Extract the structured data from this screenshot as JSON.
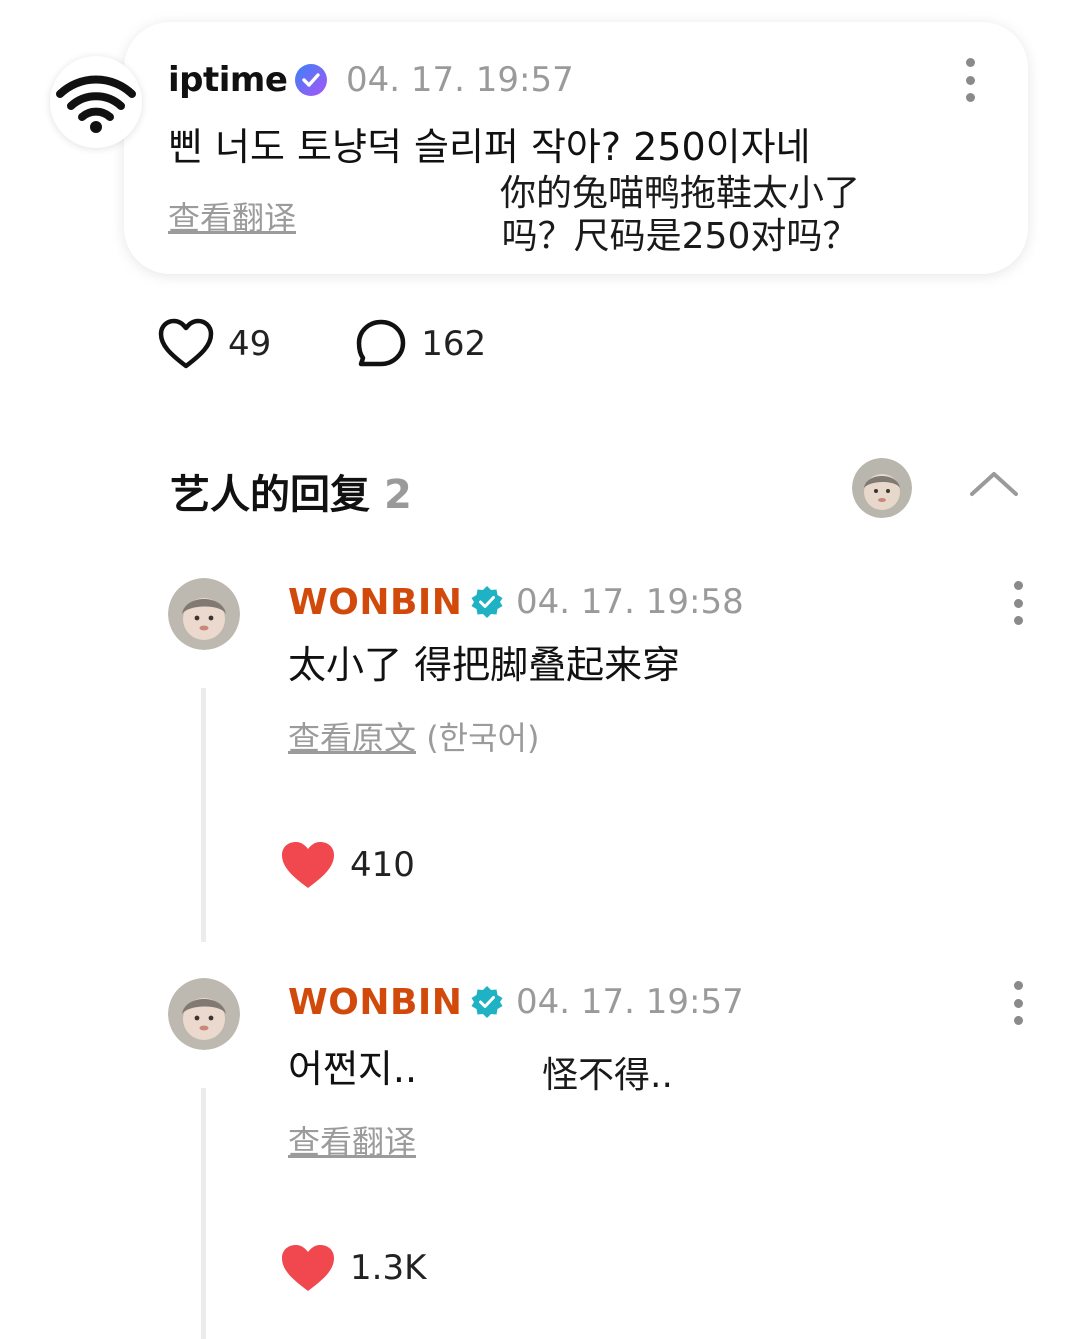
{
  "post": {
    "username": "iptime",
    "timestamp": "04. 17. 19:57",
    "text": "삔 너도 토냥덕 슬리퍼 작아? 250이자네",
    "translate_link": "查看翻译",
    "overlay_translation": "你的兔喵鸭拖鞋太小了吗？尺码是250对吗？",
    "likes": "49",
    "comments": "162"
  },
  "artist_replies": {
    "title": "艺人的回复",
    "count": "2"
  },
  "comments": [
    {
      "username": "WONBIN",
      "timestamp": "04. 17. 19:58",
      "text": "太小了 得把脚叠起来穿",
      "link_text": "查看原文",
      "link_suffix": "(한국어)",
      "likes": "410"
    },
    {
      "username": "WONBIN",
      "timestamp": "04. 17. 19:57",
      "text": "어쩐지..",
      "overlay_translation": "怪不得..",
      "link_text": "查看翻译",
      "likes": "1.3K"
    }
  ],
  "colors": {
    "artist_name": "#d24a0b",
    "verified_teal": "#1fb2c4",
    "like_red": "#f0484e",
    "muted_text": "#9a9a9a"
  },
  "icons": {
    "post_avatar": "wifi-icon",
    "post_verified": "verified-badge-icon",
    "like": "heart-outline-icon",
    "comment": "speech-bubble-icon",
    "collapse": "chevron-up-icon",
    "more": "kebab-menu-icon",
    "artist_verified": "verified-check-icon",
    "liked": "heart-filled-icon"
  }
}
